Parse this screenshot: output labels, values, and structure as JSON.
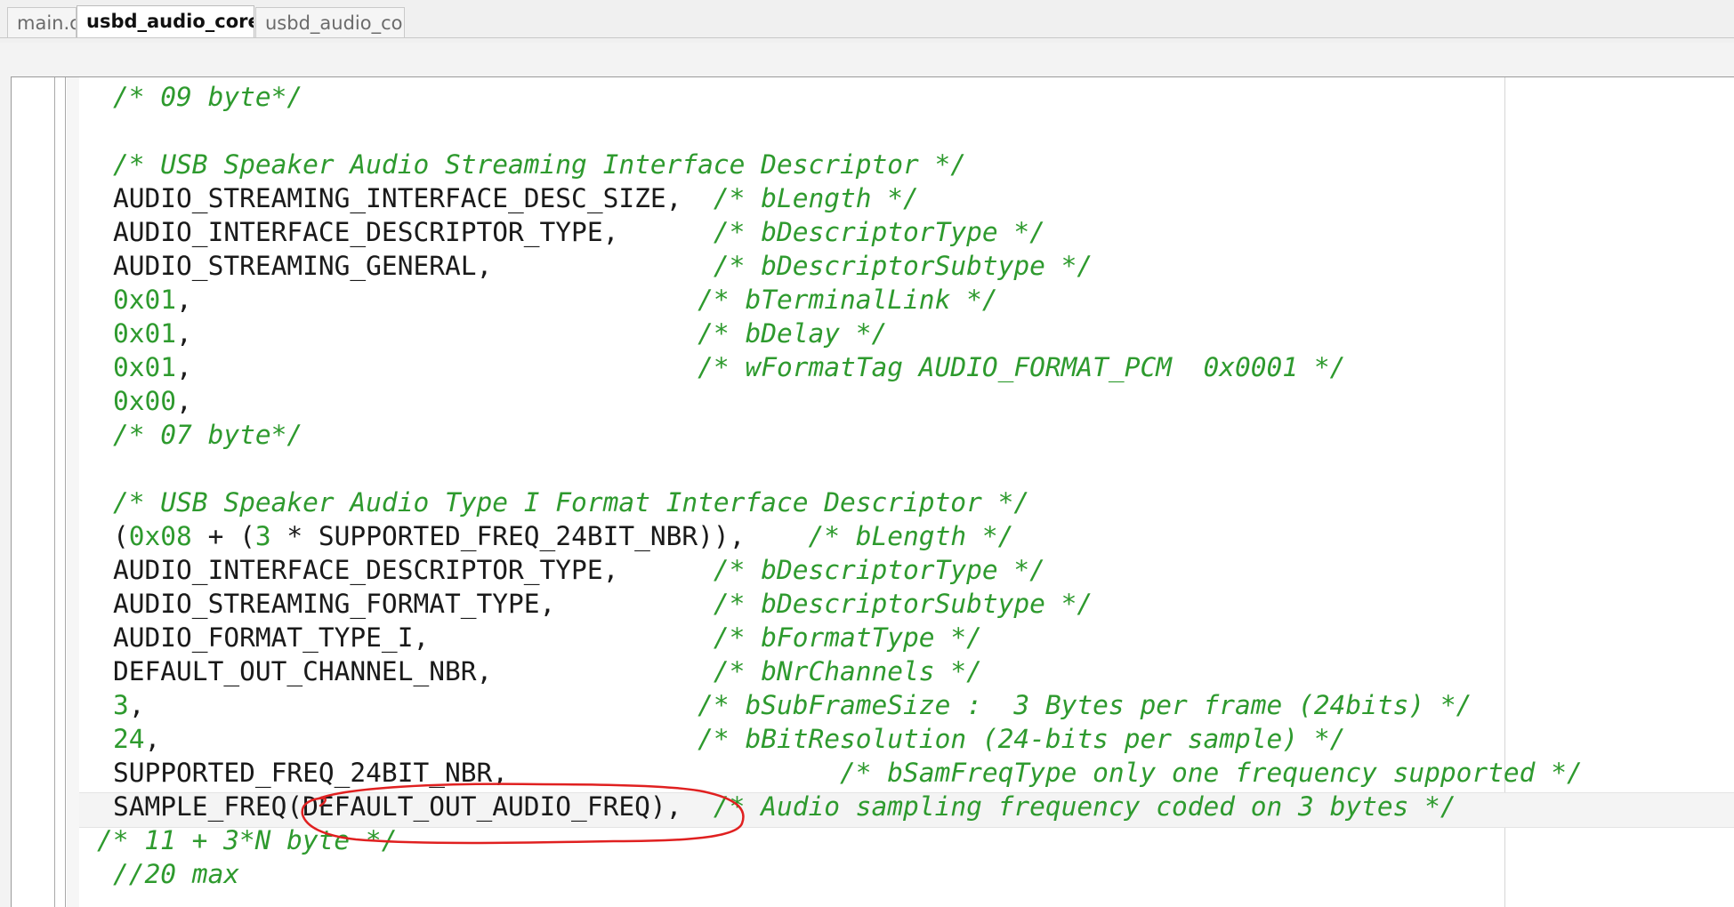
{
  "tabs": [
    {
      "label": "main.c",
      "active": false
    },
    {
      "label": "usbd_audio_core.c",
      "active": true
    },
    {
      "label": "usbd_audio_cor...",
      "active": false
    }
  ],
  "tab_close_glyph": "×",
  "colors": {
    "comment": "#2e9a2e",
    "number": "#2e9a2e",
    "identifier": "#1a1a1a",
    "annotation": "#e02020"
  },
  "code": {
    "l0": {
      "comment": "/* 09 byte*/"
    },
    "l2": {
      "comment": "/* USB Speaker Audio Streaming Interface Descriptor */"
    },
    "l3": {
      "code": "AUDIO_STREAMING_INTERFACE_DESC_SIZE,  ",
      "comment": "/* bLength */"
    },
    "l4": {
      "code": "AUDIO_INTERFACE_DESCRIPTOR_TYPE,      ",
      "comment": "/* bDescriptorType */"
    },
    "l5": {
      "code": "AUDIO_STREAMING_GENERAL,              ",
      "comment": "/* bDescriptorSubtype */"
    },
    "l6": {
      "num": "0x01",
      "code": ",                                ",
      "comment": "/* bTerminalLink */"
    },
    "l7": {
      "num": "0x01",
      "code": ",                                ",
      "comment": "/* bDelay */"
    },
    "l8": {
      "num": "0x01",
      "code": ",                                ",
      "comment": "/* wFormatTag AUDIO_FORMAT_PCM  0x0001 */"
    },
    "l9": {
      "num": "0x00",
      "code": ","
    },
    "l10": {
      "comment": "/* 07 byte*/"
    },
    "l12": {
      "comment": "/* USB Speaker Audio Type I Format Interface Descriptor */"
    },
    "l13": {
      "p1": "(",
      "num1": "0x08",
      "p2": " + (",
      "num2": "3",
      "p3": " * SUPPORTED_FREQ_24BIT_NBR)),    ",
      "comment": "/* bLength */"
    },
    "l14": {
      "code": "AUDIO_INTERFACE_DESCRIPTOR_TYPE,      ",
      "comment": "/* bDescriptorType */"
    },
    "l15": {
      "code": "AUDIO_STREAMING_FORMAT_TYPE,          ",
      "comment": "/* bDescriptorSubtype */"
    },
    "l16": {
      "code": "AUDIO_FORMAT_TYPE_I,                  ",
      "comment": "/* bFormatType */"
    },
    "l17": {
      "code": "DEFAULT_OUT_CHANNEL_NBR,              ",
      "comment": "/* bNrChannels */"
    },
    "l18": {
      "num": "3",
      "code": ",                                   ",
      "comment": "/* bSubFrameSize :  3 Bytes per frame (24bits) */"
    },
    "l19": {
      "num": "24",
      "code": ",                                  ",
      "comment": "/* bBitResolution (24-bits per sample) */"
    },
    "l20": {
      "code": "SUPPORTED_FREQ_24BIT_NBR,                     ",
      "comment": "/* bSamFreqType only one frequency supported */"
    },
    "l21": {
      "code": "SAMPLE_FREQ(DEFAULT_OUT_AUDIO_FREQ),  ",
      "comment": "/* Audio sampling frequency coded on 3 bytes */"
    },
    "l22": {
      "comment": "/* 11 + 3*N byte */"
    },
    "l23": {
      "comment": "//20 max"
    }
  }
}
